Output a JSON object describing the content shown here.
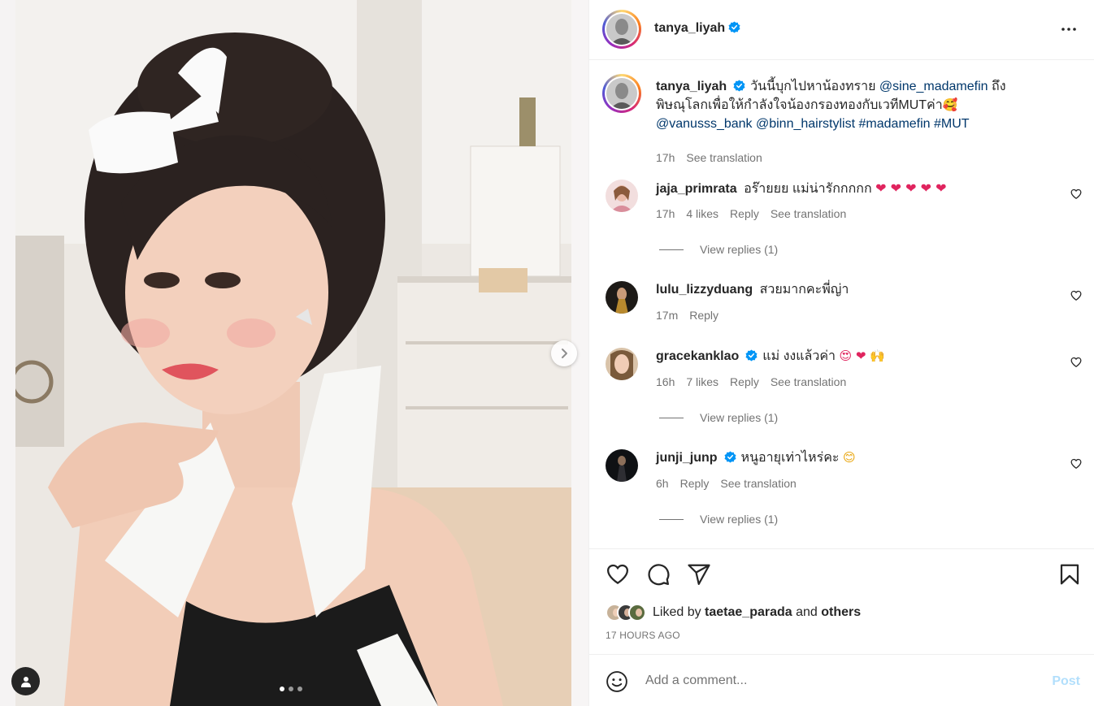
{
  "post": {
    "author": "tanya_liyah",
    "caption_part1": "วันนี้บุกไปหาน้องทราย",
    "caption_mention1": "@sine_madamefin",
    "caption_part2": "ถึงพิษณุโลกเพื่อให้กำลังใจน้องกรองทองกับเวทีMUTค่า",
    "caption_emoji": "🥰",
    "caption_mention2": "@vanusss_bank",
    "caption_mention3": "@binn_hairstylist",
    "caption_tag1": "#madamefin",
    "caption_tag2": "#MUT",
    "caption_time": "17h",
    "see_translation": "See translation",
    "carousel_dots": 3,
    "carousel_active": 0
  },
  "comments": [
    {
      "user": "jaja_primrata",
      "text": "อร๊ายยย แม่น่ารักกกกก",
      "emojis": "❤ ❤ ❤ ❤ ❤",
      "time": "17h",
      "likes": "4 likes",
      "reply": "Reply",
      "translate": "See translation",
      "view_replies": "View replies (1)"
    },
    {
      "user": "lulu_lizzyduang",
      "text": "สวยมากคะพี่ญ่า",
      "time": "17m",
      "reply": "Reply"
    },
    {
      "user": "gracekanklao",
      "text": "แม่ งงแล้วค่า",
      "emojis": "😍 ❤ 🙌",
      "time": "16h",
      "likes": "7 likes",
      "reply": "Reply",
      "translate": "See translation",
      "view_replies": "View replies (1)"
    },
    {
      "user": "junji_junp",
      "text": "หนูอายุเท่าไหร่คะ",
      "emojis": "😊",
      "time": "6h",
      "reply": "Reply",
      "translate": "See translation",
      "view_replies": "View replies (1)"
    }
  ],
  "likes": {
    "prefix": "Liked by",
    "user": "taetae_parada",
    "middle": "and",
    "others": "others",
    "timestamp": "17 HOURS AGO"
  },
  "composer": {
    "placeholder": "Add a comment...",
    "post_label": "Post"
  },
  "icons": {
    "verified": "verified-badge-icon",
    "more": "more-options-icon",
    "like": "heart-icon",
    "comment": "comment-icon",
    "share": "share-icon",
    "save": "bookmark-icon",
    "emoji": "emoji-icon",
    "next": "chevron-right-icon",
    "tag": "user-tag-icon"
  },
  "colors": {
    "verified": "#0095f6",
    "link": "#00376b",
    "muted": "#737373",
    "post_disabled": "#b2dffc"
  }
}
